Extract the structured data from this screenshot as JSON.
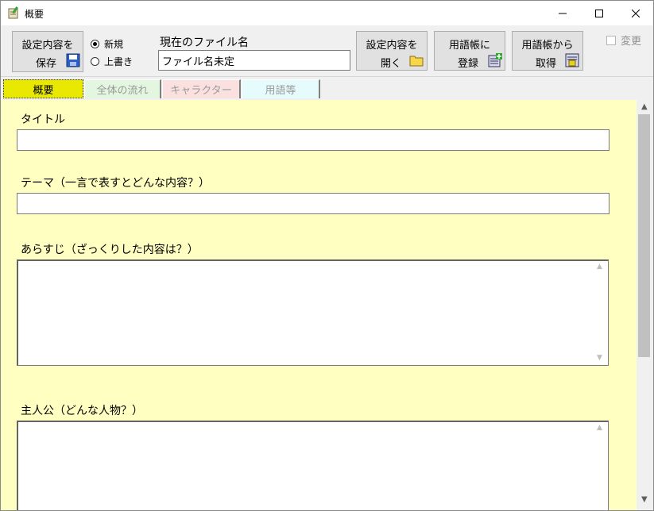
{
  "window": {
    "title": "概要"
  },
  "toolbar": {
    "save": {
      "line1": "設定内容を",
      "line2": "保存"
    },
    "mode_new": "新規",
    "mode_overwrite": "上書き",
    "current_file_label": "現在のファイル名",
    "current_file_value": "ファイル名未定",
    "open": {
      "line1": "設定内容を",
      "line2": "開く"
    },
    "register": {
      "line1": "用語帳に",
      "line2": "登録"
    },
    "fetch": {
      "line1": "用語帳から",
      "line2": "取得"
    },
    "changed_label": "変更"
  },
  "tabs": [
    {
      "label": "概要"
    },
    {
      "label": "全体の流れ"
    },
    {
      "label": "キャラクター"
    },
    {
      "label": "用語等"
    }
  ],
  "form": {
    "title_label": "タイトル",
    "title_value": "",
    "theme_label": "テーマ（一言で表すとどんな内容？）",
    "theme_value": "",
    "synopsis_label": "あらすじ（ざっくりした内容は？）",
    "synopsis_value": "",
    "protagonist_label": "主人公（どんな人物？）",
    "protagonist_value": ""
  }
}
